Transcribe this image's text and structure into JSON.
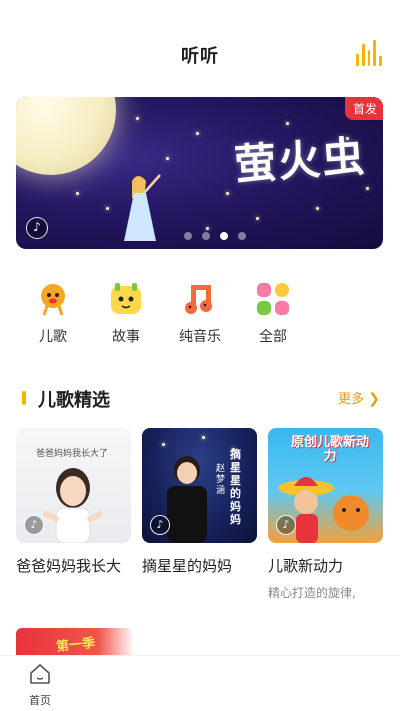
{
  "header": {
    "title": "听听"
  },
  "banner": {
    "badge": "首发",
    "title": "萤火虫",
    "slide_count": 4,
    "active_slide": 3
  },
  "categories": [
    {
      "label": "儿歌",
      "icon": "children-song-icon"
    },
    {
      "label": "故事",
      "icon": "story-icon"
    },
    {
      "label": "纯音乐",
      "icon": "pure-music-icon"
    },
    {
      "label": "全部",
      "icon": "all-categories-icon"
    }
  ],
  "section": {
    "title": "儿歌精选",
    "more": "更多"
  },
  "cards": [
    {
      "title": "爸爸妈妈我长大",
      "subtitle": "",
      "cover_text": "爸爸妈妈我长大了"
    },
    {
      "title": "摘星星的妈妈",
      "subtitle": "",
      "cover_text": "摘星星的妈妈",
      "cover_artist": "赵梦涵"
    },
    {
      "title": "儿歌新动力",
      "subtitle": "精心打造的旋律,",
      "cover_text": "原创儿歌新动力"
    }
  ],
  "peek_banner": {
    "text": "第一季"
  },
  "bottom_nav": {
    "home_label": "首页"
  },
  "colors": {
    "accent": "#f5b400",
    "badge": "#e8323c",
    "more": "#e5a100"
  }
}
